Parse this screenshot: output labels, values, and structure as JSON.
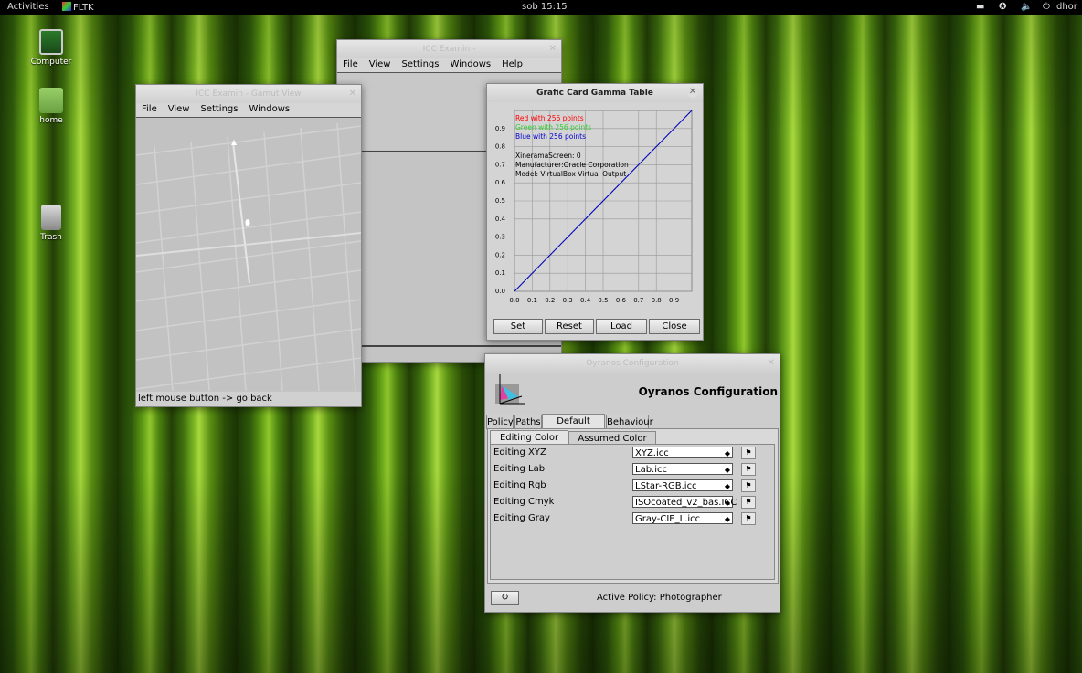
{
  "topbar": {
    "activities": "Activities",
    "app": "FLTK",
    "clock": "sob 15:15",
    "user": "dhor"
  },
  "desktop": {
    "computer": "Computer",
    "home": "home",
    "trash": "Trash"
  },
  "icc_main": {
    "title": "ICC Examin - ",
    "menu": [
      "File",
      "View",
      "Settings",
      "Windows",
      "Help"
    ]
  },
  "gamut": {
    "title": "ICC Examin - Gamut View",
    "menu": [
      "File",
      "View",
      "Settings",
      "Windows"
    ],
    "status": "left mouse button -> go back"
  },
  "gamma": {
    "title": "Grafic Card Gamma Table",
    "legend": {
      "red": "Red with 256 points",
      "green": "Green with 256 points",
      "blue": "Blue with 256 points"
    },
    "info": [
      "XineramaScreen: 0",
      "Manufacturer:Oracle Corporation",
      "Model:      VirtualBox Virtual Output"
    ],
    "buttons": {
      "set": "Set",
      "reset": "Reset",
      "load": "Load",
      "close": "Close"
    },
    "colors": {
      "red": "#ff0000",
      "green": "#33cc33",
      "blue": "#0000cc"
    }
  },
  "oyranos": {
    "window_title": "Oyranos Configuration",
    "heading": "Oyranos Configuration",
    "tabs": [
      "Policy",
      "Paths",
      "Default Profiles",
      "Behaviour"
    ],
    "subtabs": [
      "Editing Color Space",
      "Assumed Color Space"
    ],
    "rows": [
      {
        "label": "Editing XYZ",
        "value": "XYZ.icc"
      },
      {
        "label": "Editing Lab",
        "value": "Lab.icc"
      },
      {
        "label": "Editing Rgb",
        "value": "LStar-RGB.icc"
      },
      {
        "label": "Editing Cmyk",
        "value": "ISOcoated_v2_bas.ICC"
      },
      {
        "label": "Editing Gray",
        "value": "Gray-CIE_L.icc"
      }
    ],
    "active_policy_label": "Active Policy:",
    "active_policy": "Photographer"
  },
  "chart_data": {
    "type": "line",
    "title": "",
    "xlabel": "",
    "ylabel": "",
    "x_ticks": [
      0.0,
      0.1,
      0.2,
      0.3,
      0.4,
      0.5,
      0.6,
      0.7,
      0.8,
      0.9
    ],
    "y_ticks": [
      0.0,
      0.1,
      0.2,
      0.3,
      0.4,
      0.5,
      0.6,
      0.7,
      0.8,
      0.9
    ],
    "xlim": [
      0,
      1
    ],
    "ylim": [
      0,
      1
    ],
    "grid": true,
    "series": [
      {
        "name": "Red with 256 points",
        "x": [
          0,
          1
        ],
        "y": [
          0,
          1
        ]
      },
      {
        "name": "Green with 256 points",
        "x": [
          0,
          1
        ],
        "y": [
          0,
          1
        ]
      },
      {
        "name": "Blue with 256 points",
        "x": [
          0,
          1
        ],
        "y": [
          0,
          1
        ]
      }
    ]
  }
}
